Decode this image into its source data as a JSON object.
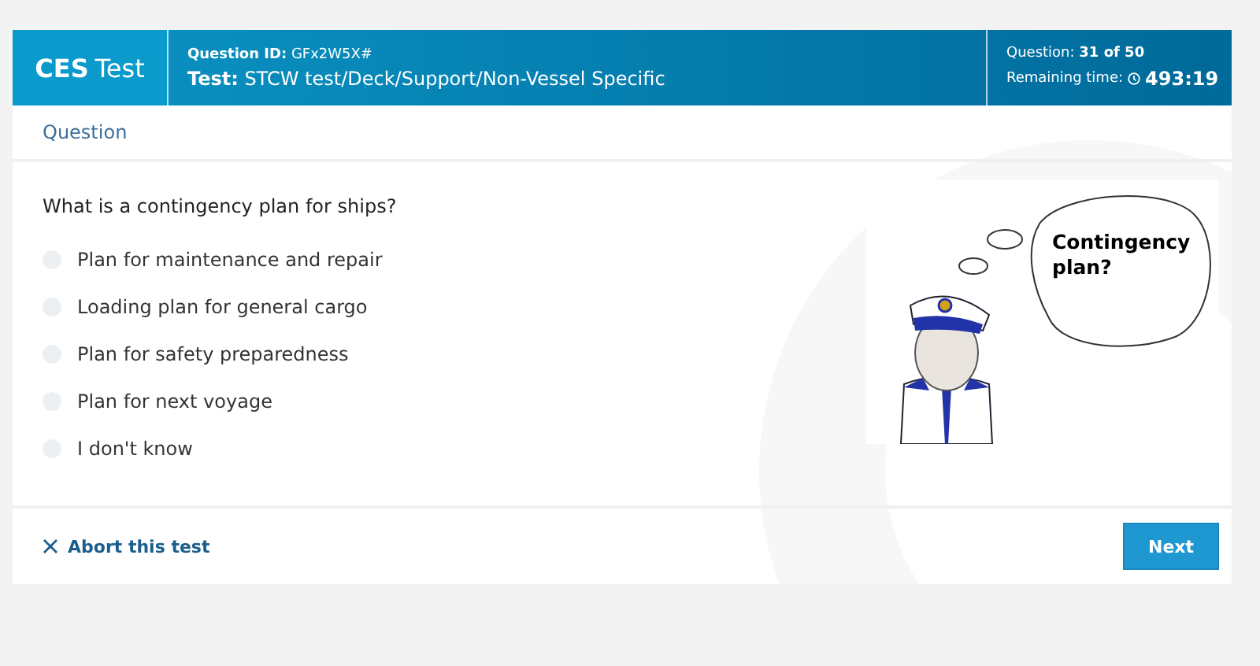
{
  "header": {
    "logo": {
      "bold": "CES",
      "light": "Test"
    },
    "question_id_label": "Question ID:",
    "question_id": "GFx2W5X#",
    "test_label": "Test:",
    "test_path": "STCW test/Deck/Support/Non-Vessel Specific",
    "progress_label": "Question:",
    "progress": "31 of 50",
    "time_label": "Remaining time:",
    "time": "493:19"
  },
  "section_tab": "Question",
  "question": "What is a contingency plan for ships?",
  "options": [
    {
      "label": "Plan for maintenance and repair",
      "selected": false
    },
    {
      "label": "Loading plan for general cargo",
      "selected": false
    },
    {
      "label": "Plan for safety preparedness",
      "selected": false
    },
    {
      "label": "Plan for next voyage",
      "selected": false
    },
    {
      "label": "I don't know",
      "selected": false
    }
  ],
  "illustration": {
    "bubble_text": "Contingency plan?"
  },
  "footer": {
    "abort": "Abort this test",
    "next": "Next"
  }
}
